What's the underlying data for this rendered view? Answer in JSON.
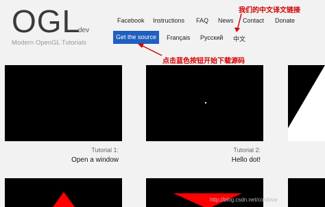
{
  "logo": {
    "title": "OGL",
    "dev": "dev",
    "tagline": "Modern OpenGL Tutorials"
  },
  "nav": {
    "facebook": "Facebook",
    "instructions": "Instructions",
    "faq": "FAQ",
    "news": "News",
    "contact": "Contact",
    "donate": "Donate"
  },
  "lang": {
    "source": "Get the source",
    "fr": "Français",
    "ru": "Русский",
    "zh": "中文"
  },
  "annotations": {
    "top": "我们的中文译文链接",
    "middle": "点击蓝色按钮开始下载源码"
  },
  "tutorials": [
    {
      "num": "Tutorial 1:",
      "title": "Open a window"
    },
    {
      "num": "Tutorial 2:",
      "title": "Hello dot!"
    }
  ],
  "watermark": "http://blog.csdn.net/cordova",
  "colors": {
    "button": "#1f5fbf",
    "annotation": "#d40000",
    "triangle": "#ff0000"
  }
}
